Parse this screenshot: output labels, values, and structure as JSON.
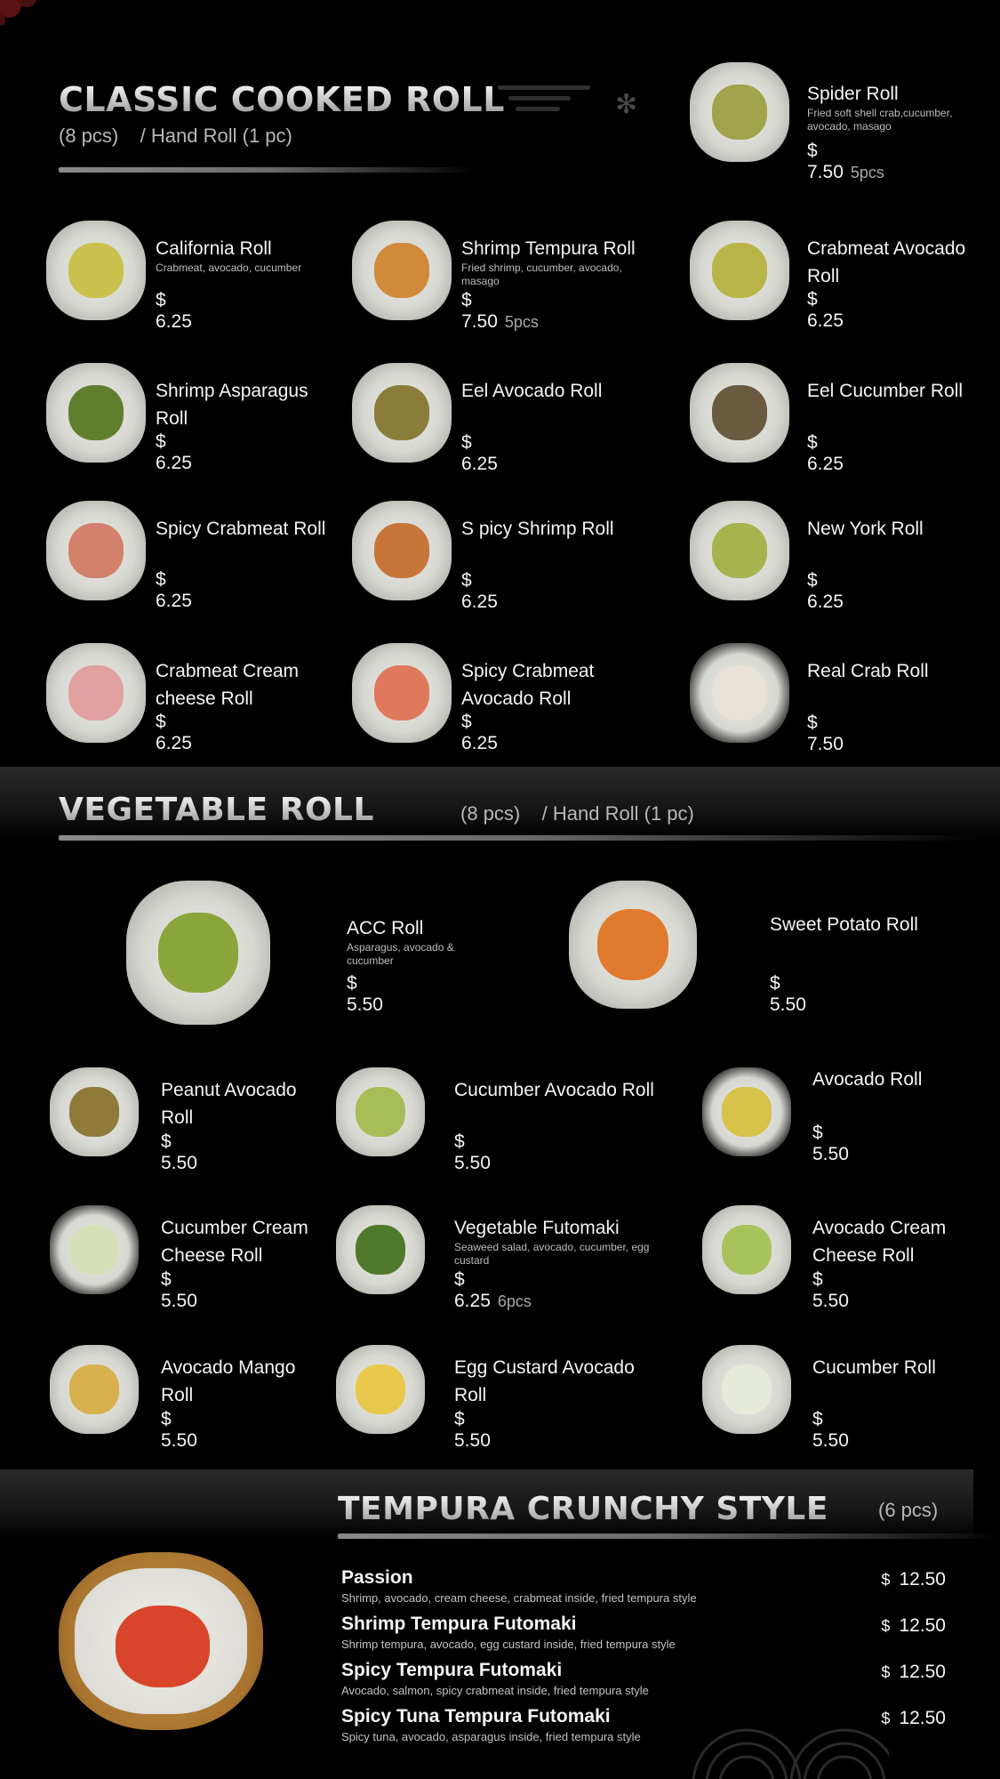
{
  "classic": {
    "title": "CLASSIC COOKED ROLL",
    "subtitle": "(8 pcs)    / Hand Roll (1 pc)",
    "items": [
      {
        "name": "Spider Roll",
        "desc": "Fried soft shell crab,cucumber, avocado, masago",
        "price": "$ 7.50",
        "pcs": "5pcs",
        "fill": "#9fa34a"
      },
      {
        "name": "California Roll",
        "desc": "Crabmeat, avocado, cucumber",
        "price": "$ 6.25",
        "pcs": "",
        "fill": "#c9c24f"
      },
      {
        "name": "Shrimp Tempura Roll",
        "desc": "Fried shrimp, cucumber, avocado, masago",
        "price": "$ 7.50",
        "pcs": "5pcs",
        "fill": "#d08a3a"
      },
      {
        "name": "Crabmeat Avocado Roll",
        "desc": "",
        "price": "$ 6.25",
        "pcs": "",
        "fill": "#b9b549"
      },
      {
        "name": "Shrimp Asparagus Roll",
        "desc": "",
        "price": "$ 6.25",
        "pcs": "",
        "fill": "#5f7f2e"
      },
      {
        "name": "Eel Avocado Roll",
        "desc": "",
        "price": "$ 6.25",
        "pcs": "",
        "fill": "#8a7c3a"
      },
      {
        "name": "Eel Cucumber Roll",
        "desc": "",
        "price": "$ 6.25",
        "pcs": "",
        "fill": "#6a5a3f"
      },
      {
        "name": "Spicy Crabmeat Roll",
        "desc": "",
        "price": "$ 6.25",
        "pcs": "",
        "fill": "#d3806b"
      },
      {
        "name": "S picy Shrimp Roll",
        "desc": "",
        "price": "$ 6.25",
        "pcs": "",
        "fill": "#c7763a"
      },
      {
        "name": "New York Roll",
        "desc": "",
        "price": "$ 6.25",
        "pcs": "",
        "fill": "#a7b34d"
      },
      {
        "name": "Crabmeat Cream cheese Roll",
        "desc": "",
        "price": "$ 6.25",
        "pcs": "",
        "fill": "#e2a1a1"
      },
      {
        "name": "Spicy Crabmeat Avocado Roll",
        "desc": "",
        "price": "$ 6.25",
        "pcs": "",
        "fill": "#e0795c"
      },
      {
        "name": "Real Crab Roll",
        "desc": "",
        "price": "$ 7.50",
        "pcs": "",
        "fill": "#e8e2d8"
      }
    ]
  },
  "vegetable": {
    "title": "VEGETABLE ROLL",
    "subtitle": "(8 pcs)    / Hand Roll (1 pc)",
    "items": [
      {
        "name": "ACC Roll",
        "desc": "Asparagus, avocado & cucumber",
        "price": "$ 5.50",
        "pcs": "",
        "fill": "#8aa63a"
      },
      {
        "name": "Sweet Potato Roll",
        "desc": "",
        "price": "$ 5.50",
        "pcs": "",
        "fill": "#e07a2e"
      },
      {
        "name": "Peanut Avocado Roll",
        "desc": "",
        "price": "$ 5.50",
        "pcs": "",
        "fill": "#8f7a3a"
      },
      {
        "name": "Cucumber Avocado Roll",
        "desc": "",
        "price": "$ 5.50",
        "pcs": "",
        "fill": "#a7bd57"
      },
      {
        "name": "Avocado Roll",
        "desc": "",
        "price": "$ 5.50",
        "pcs": "",
        "fill": "#d7c24a"
      },
      {
        "name": "Cucumber Cream Cheese Roll",
        "desc": "",
        "price": "$ 5.50",
        "pcs": "",
        "fill": "#d6e0b8"
      },
      {
        "name": "Vegetable Futomaki",
        "desc": "Seaweed salad, avocado, cucumber, egg custard",
        "price": "$ 6.25",
        "pcs": "6pcs",
        "fill": "#4f7a2c"
      },
      {
        "name": "Avocado Cream Cheese Roll",
        "desc": "",
        "price": "$ 5.50",
        "pcs": "",
        "fill": "#a9c35c"
      },
      {
        "name": "Avocado Mango Roll",
        "desc": "",
        "price": "$ 5.50",
        "pcs": "",
        "fill": "#d8b14e"
      },
      {
        "name": "Egg Custard Avocado Roll",
        "desc": "",
        "price": "$ 5.50",
        "pcs": "",
        "fill": "#e8c84a"
      },
      {
        "name": "Cucumber Roll",
        "desc": "",
        "price": "$ 5.50",
        "pcs": "",
        "fill": "#e6ead8"
      }
    ]
  },
  "tempura": {
    "title": "TEMPURA CRUNCHY STYLE",
    "subtitle": "(6 pcs)",
    "items": [
      {
        "name": "Passion",
        "desc": "Shrimp, avocado, cream cheese, crabmeat inside, fried tempura style",
        "price": "12.50"
      },
      {
        "name": "Shrimp Tempura Futomaki",
        "desc": "Shrimp tempura, avocado, egg custard inside, fried tempura style",
        "price": "12.50"
      },
      {
        "name": "Spicy Tempura Futomaki",
        "desc": "Avocado, salmon, spicy crabmeat inside, fried tempura style",
        "price": "12.50"
      },
      {
        "name": "Spicy Tuna Tempura Futomaki",
        "desc": "Spicy tuna, avocado, asparagus inside, fried tempura style",
        "price": "12.50"
      }
    ],
    "currency": "$"
  }
}
